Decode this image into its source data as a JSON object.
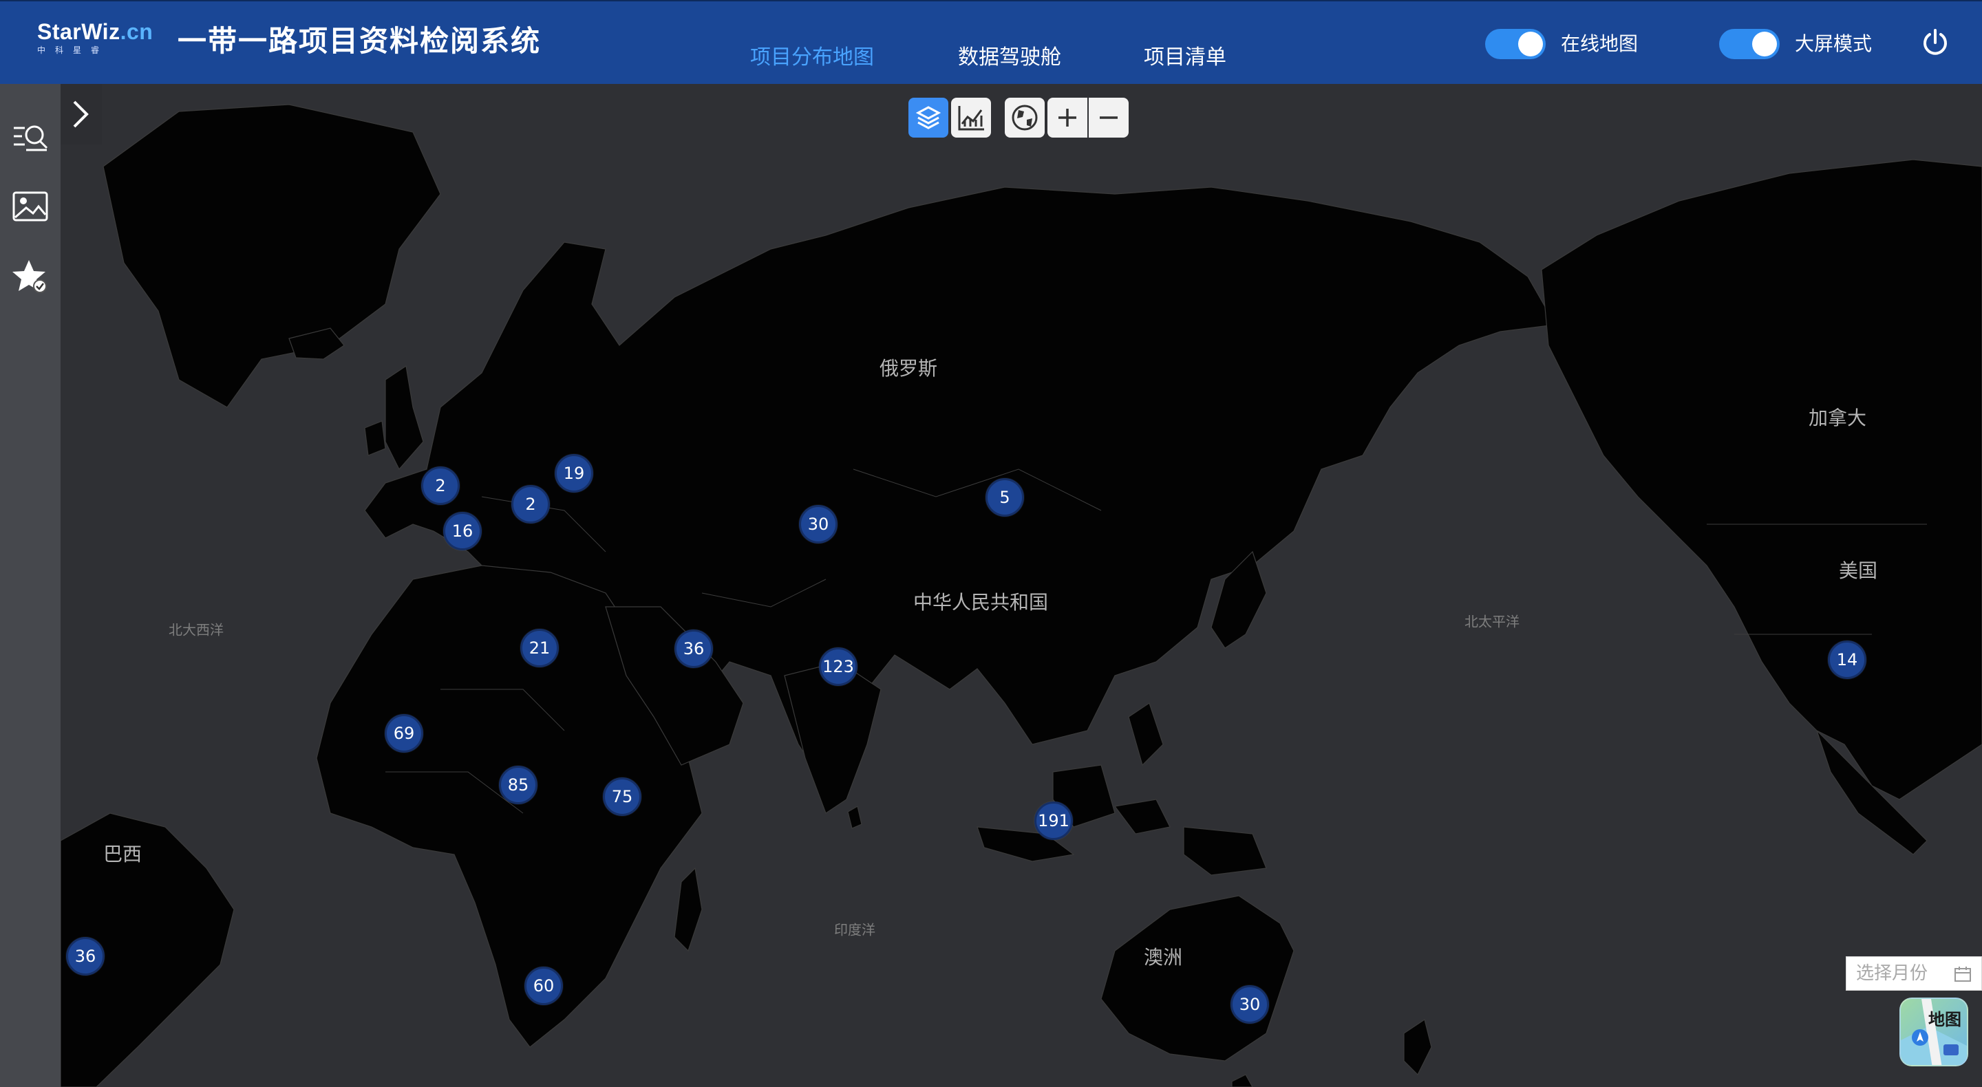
{
  "header": {
    "brand_name": "StarWiz",
    "brand_suffix": ".cn",
    "brand_sub": "中科星睿",
    "title": "一带一路项目资料检阅系统",
    "nav": [
      {
        "label": "项目分布地图",
        "active": true
      },
      {
        "label": "数据驾驶舱",
        "active": false
      },
      {
        "label": "项目清单",
        "active": false
      }
    ],
    "toggles": [
      {
        "label": "在线地图",
        "on": true
      },
      {
        "label": "大屏模式",
        "on": true
      }
    ],
    "power_icon": "power-icon"
  },
  "sidebar": {
    "expand_icon": "chevron-right-icon",
    "buttons": [
      {
        "icon": "search-list-icon"
      },
      {
        "icon": "image-icon"
      },
      {
        "icon": "star-check-icon"
      }
    ]
  },
  "toolbar": {
    "buttons": [
      {
        "icon": "layers-icon",
        "active": true
      },
      {
        "icon": "chart-icon",
        "active": false
      },
      {
        "icon": "globe-icon",
        "active": false
      },
      {
        "icon": "zoom-in-icon",
        "active": false
      },
      {
        "icon": "zoom-out-icon",
        "active": false
      }
    ]
  },
  "map": {
    "labels": {
      "russia": "俄罗斯",
      "china": "中华人民共和国",
      "canada": "加拿大",
      "usa": "美国",
      "australia": "澳洲",
      "brazil": "巴西",
      "north_atlantic": "北大西洋",
      "north_pacific": "北太平洋",
      "indian_ocean": "印度洋"
    },
    "clusters": [
      {
        "count": "2"
      },
      {
        "count": "19"
      },
      {
        "count": "2"
      },
      {
        "count": "16"
      },
      {
        "count": "30"
      },
      {
        "count": "5"
      },
      {
        "count": "21"
      },
      {
        "count": "36"
      },
      {
        "count": "123"
      },
      {
        "count": "69"
      },
      {
        "count": "85"
      },
      {
        "count": "75"
      },
      {
        "count": "191"
      },
      {
        "count": "14"
      },
      {
        "count": "36"
      },
      {
        "count": "60"
      },
      {
        "count": "30"
      }
    ]
  },
  "month_picker": {
    "placeholder": "选择月份",
    "icon": "calendar-icon"
  },
  "map_app": {
    "label": "地图"
  },
  "colors": {
    "header_bg": "#1a4796",
    "nav_active": "#49a3ff",
    "toggle_on": "#2f8cf0",
    "cluster_bg": "#1d4595",
    "land": "#030303",
    "sea": "#2f3034"
  }
}
